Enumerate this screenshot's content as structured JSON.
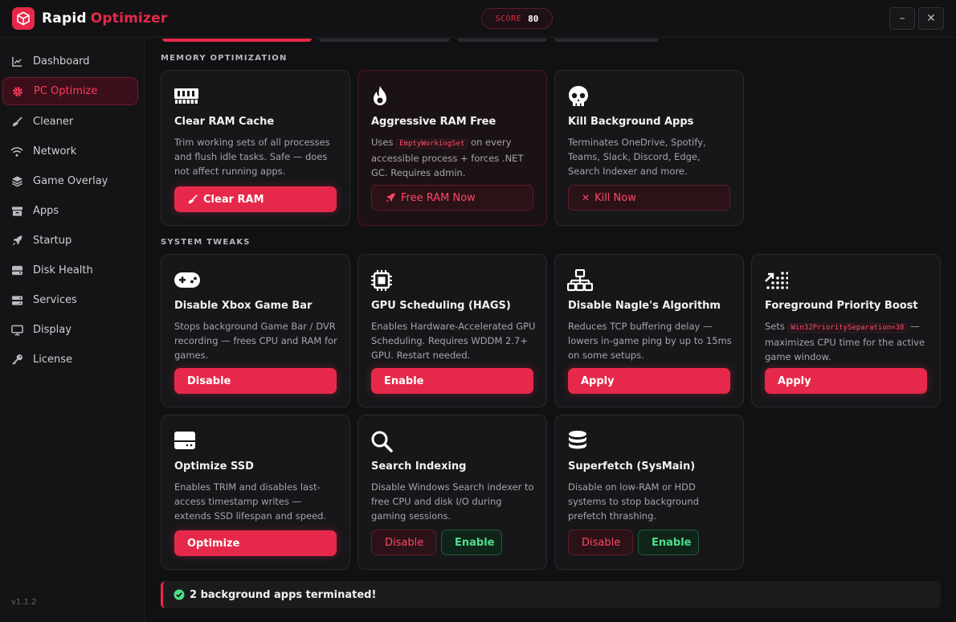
{
  "app": {
    "name_part1": "Rapid",
    "name_part2": "Optimizer",
    "score_label": "SCORE",
    "score_value": "80",
    "minimize": "–",
    "close": "✕"
  },
  "sidebar": {
    "items": [
      {
        "label": "Dashboard",
        "icon": "chart-line-icon"
      },
      {
        "label": "PC Optimize",
        "icon": "gear-icon",
        "active": true
      },
      {
        "label": "Cleaner",
        "icon": "broom-icon"
      },
      {
        "label": "Network",
        "icon": "wifi-icon"
      },
      {
        "label": "Game Overlay",
        "icon": "layers-icon"
      },
      {
        "label": "Apps",
        "icon": "box-icon"
      },
      {
        "label": "Startup",
        "icon": "rocket-icon"
      },
      {
        "label": "Disk Health",
        "icon": "hdd-icon"
      },
      {
        "label": "Services",
        "icon": "server-icon"
      },
      {
        "label": "Display",
        "icon": "monitor-icon"
      },
      {
        "label": "License",
        "icon": "key-icon"
      }
    ],
    "version": "v1.1.2"
  },
  "memory": {
    "title": "MEMORY OPTIMIZATION",
    "cards": [
      {
        "title": "Clear RAM Cache",
        "desc": "Trim working sets of all processes and flush idle tasks. Safe — does not affect running apps.",
        "button": "Clear RAM",
        "icon": "memory-icon"
      },
      {
        "title": "Aggressive RAM Free",
        "desc_pre": "Uses ",
        "desc_code": "EmptyWorkingSet",
        "desc_post": " on every accessible process + forces .NET GC. Requires admin.",
        "button": "Free RAM Now",
        "icon": "fire-icon"
      },
      {
        "title": "Kill Background Apps",
        "desc": "Terminates OneDrive, Spotify, Teams, Slack, Discord, Edge, Search Indexer and more.",
        "button": "Kill Now",
        "icon": "skull-icon"
      }
    ]
  },
  "tweaks": {
    "title": "SYSTEM TWEAKS",
    "cards": [
      {
        "title": "Disable Xbox Game Bar",
        "desc": "Stops background Game Bar / DVR recording — frees CPU and RAM for games.",
        "button": "Disable",
        "icon": "gamepad-icon"
      },
      {
        "title": "GPU Scheduling (HAGS)",
        "desc": "Enables Hardware-Accelerated GPU Scheduling. Requires WDDM 2.7+ GPU. Restart needed.",
        "button": "Enable",
        "icon": "chip-icon"
      },
      {
        "title": "Disable Nagle's Algorithm",
        "desc": "Reduces TCP buffering delay — lowers in-game ping by up to 15ms on some setups.",
        "button": "Apply",
        "icon": "network-icon"
      },
      {
        "title": "Foreground Priority Boost",
        "desc_pre": "Sets ",
        "desc_code": "Win32PrioritySeparation=38",
        "desc_post": " — maximizes CPU time for the active game window.",
        "button": "Apply",
        "icon": "priority-icon"
      },
      {
        "title": "Optimize SSD",
        "desc": "Enables TRIM and disables last-access timestamp writes — extends SSD lifespan and speed.",
        "button": "Optimize",
        "icon": "ssd-icon"
      },
      {
        "title": "Search Indexing",
        "desc": "Disable Windows Search indexer to free CPU and disk I/O during gaming sessions.",
        "button_a": "Disable",
        "button_b": "Enable",
        "icon": "search-icon"
      },
      {
        "title": "Superfetch (SysMain)",
        "desc": "Disable on low-RAM or HDD systems to stop background prefetch thrashing.",
        "button_a": "Disable",
        "button_b": "Enable",
        "icon": "database-icon"
      }
    ]
  },
  "toast": {
    "text": "2 background apps terminated!",
    "icon": "check-circle-icon"
  },
  "colors": {
    "accent": "#e6294a",
    "success": "#4be08a",
    "background": "#111113"
  }
}
